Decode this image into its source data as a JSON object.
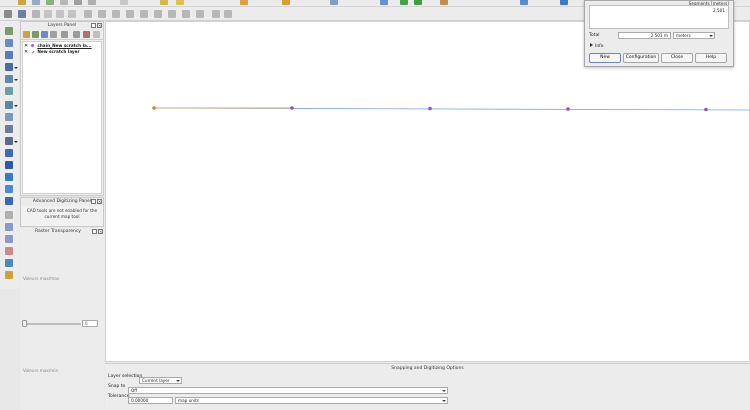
{
  "layers_panel": {
    "title": "Layers Panel",
    "layers": [
      {
        "name": "chain_New scratch la...",
        "active": true
      },
      {
        "name": "New scratch layer",
        "active": false
      }
    ]
  },
  "advanced_digitizing": {
    "title": "Advanced Digitizing Panel",
    "message": "CAD tools are not enabled for the current map tool"
  },
  "raster_transparency": {
    "title": "Raster Transparency",
    "values_max_label": "Valeurs max/max",
    "values_min_label": "Valeurs max/min",
    "spin_value": "0"
  },
  "snapping": {
    "title": "Snapping and Digitizing Options",
    "layer_selection_label": "Layer selection",
    "layer_selection_value": "Current layer",
    "snap_to_label": "Snap to",
    "snap_to_value": "Off",
    "tolerance_label": "Tolerance",
    "tolerance_value": "0.00000",
    "tolerance_units": "map units"
  },
  "measure": {
    "header": "Segments [meters]",
    "segments": [
      "2.501"
    ],
    "total_label": "Total",
    "total_value": "2.501 m",
    "units": "meters",
    "info_label": "Info",
    "buttons": {
      "new": "New",
      "configuration": "Configuration",
      "close": "Close",
      "help": "Help"
    }
  },
  "colors": {
    "measured_segment": "#c8a878",
    "snap_line": "#7aa6d6",
    "vertex": "#8a55c8",
    "start_vertex": "#d08040"
  }
}
